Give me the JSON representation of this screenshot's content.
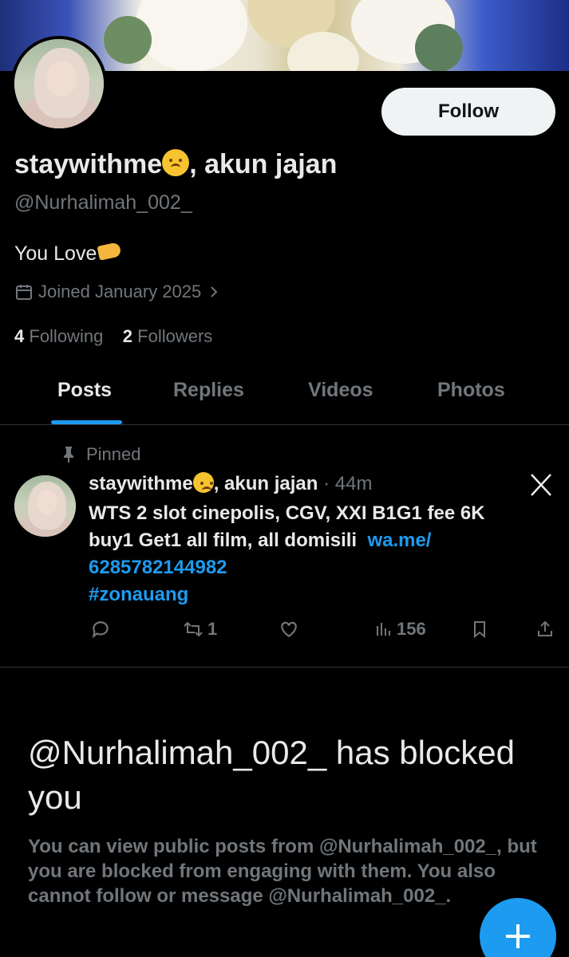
{
  "banner": {
    "alt": "banner-image"
  },
  "profile": {
    "name_part1": "staywithme",
    "name_part2": ", akun jajan",
    "handle": "@Nurhalimah_002_",
    "bio": "You Love",
    "joined": "Joined January 2025",
    "following_count": "4",
    "following_label": "Following",
    "followers_count": "2",
    "followers_label": "Followers",
    "follow_button": "Follow"
  },
  "tabs": [
    "Posts",
    "Replies",
    "Videos",
    "Photos"
  ],
  "active_tab": "Posts",
  "pinned_post": {
    "pinned_label": "Pinned",
    "author_part1": "staywithme",
    "author_part2": ", akun jajan",
    "time": "· 44m",
    "text_line1": "WTS 2 slot cinepolis, CGV, XXI B1G1 fee 6K",
    "text_line2": "buy1 Get1 all film, all domisili",
    "link_part1": "wa.me/",
    "link_part2": "6285782144982",
    "hashtag": "#zonauang",
    "retweets": "1",
    "views": "156"
  },
  "blocked": {
    "title": "@Nurhalimah_002_ has blocked you",
    "description": "You can view public posts from @Nurhalimah_002_, but you are blocked from engaging with them. You also cannot follow or message @Nurhalimah_002_."
  },
  "fab_icon": "plus-icon"
}
